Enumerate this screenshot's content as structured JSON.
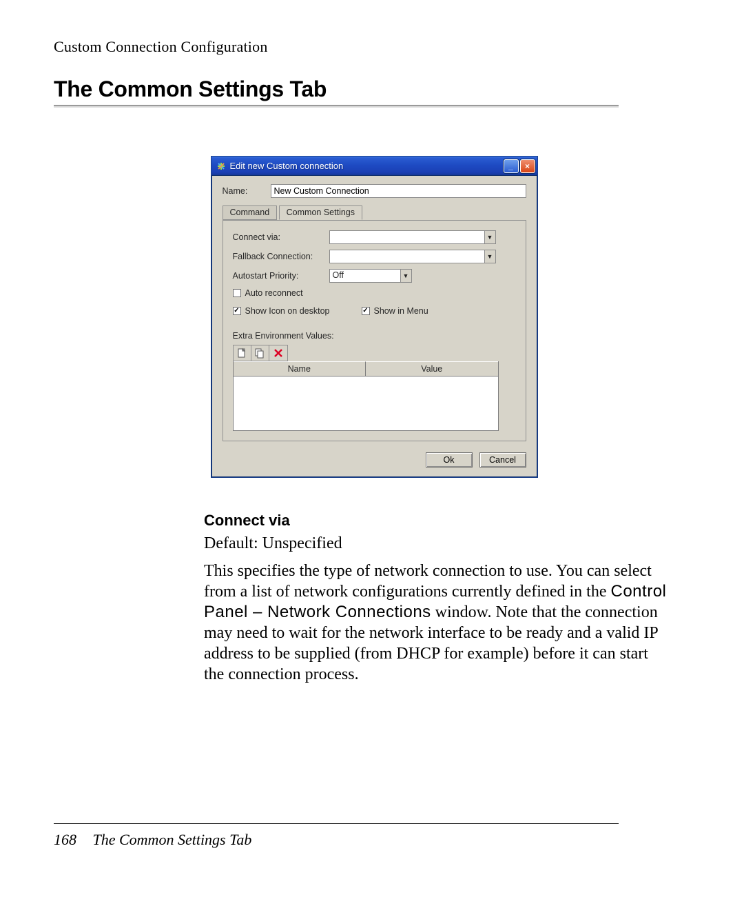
{
  "page": {
    "header": "Custom Connection Configuration",
    "heading": "The Common Settings Tab",
    "page_number": "168",
    "footer_title": "The Common Settings Tab"
  },
  "window": {
    "title": "Edit new Custom connection",
    "name_label": "Name:",
    "name_value": "New Custom Connection",
    "tabs": {
      "command": "Command",
      "common": "Common Settings"
    },
    "fields": {
      "connect_via_label": "Connect via:",
      "connect_via_value": "",
      "fallback_label": "Fallback Connection:",
      "fallback_value": "",
      "autostart_label": "Autostart Priority:",
      "autostart_value": "Off",
      "auto_reconnect_label": "Auto reconnect",
      "show_icon_label": "Show Icon on desktop",
      "show_menu_label": "Show in Menu"
    },
    "env": {
      "label": "Extra Environment Values:",
      "cols": {
        "name": "Name",
        "value": "Value"
      }
    },
    "buttons": {
      "ok": "Ok",
      "cancel": "Cancel"
    }
  },
  "body": {
    "subhead": "Connect via",
    "p1": "Default: Unspecified",
    "p2a": "This specifies the type of network connection to use. You can select from a list of network configurations currently defined in the ",
    "p2_code": "Control Panel – Network Connections",
    "p2b": " window. Note that the connection may need to wait for the network interface to be ready and a valid IP address to be supplied (from DHCP for example) before it can start the connection process."
  }
}
